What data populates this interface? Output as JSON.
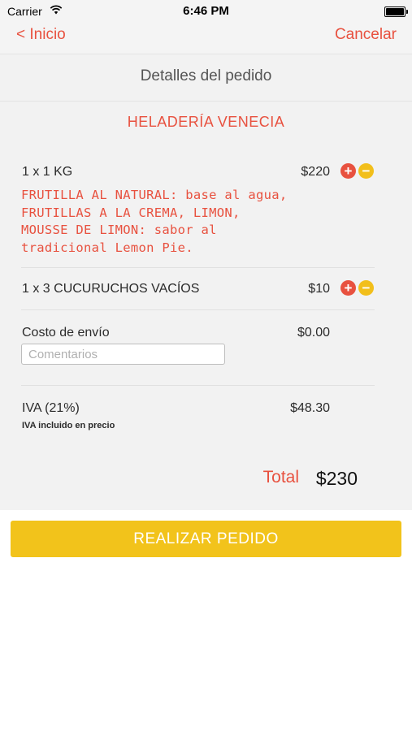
{
  "status_bar": {
    "carrier": "Carrier",
    "time": "6:46 PM"
  },
  "nav": {
    "back_label": "< Inicio",
    "cancel_label": "Cancelar"
  },
  "page": {
    "title": "Detalles del pedido",
    "store_name": "HELADERÍA VENECIA"
  },
  "items": [
    {
      "title": "1 x 1 KG",
      "price": "$220",
      "description": "FRUTILLA AL NATURAL: base al agua, FRUTILLAS A LA CREMA, LIMON, MOUSSE DE LIMON: sabor al tradicional Lemon Pie."
    },
    {
      "title": "1 x 3 CUCURUCHOS VACÍOS",
      "price": "$10"
    }
  ],
  "controls": {
    "plus": "+",
    "minus": "−"
  },
  "shipping": {
    "label": "Costo de envío",
    "value": "$0.00"
  },
  "comments": {
    "placeholder": "Comentarios",
    "value": ""
  },
  "tax": {
    "label": "IVA (21%)",
    "value": "$48.30",
    "note": "IVA incluido en precio"
  },
  "total": {
    "label": "Total",
    "value": "$230"
  },
  "order_button": {
    "label": "REALIZAR PEDIDO"
  },
  "colors": {
    "accent": "#e8513f",
    "button": "#f2c31b",
    "minus": "#f2bf1b",
    "background": "#f2f2f2"
  }
}
